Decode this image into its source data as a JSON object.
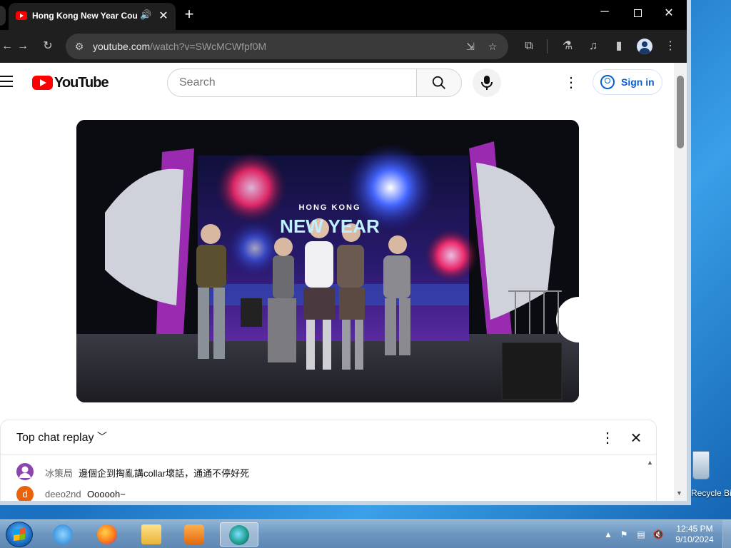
{
  "browser": {
    "tab_title": "Hong Kong New Year Countdown",
    "url_host": "youtube.com",
    "url_path": "/watch?v=SWcMCWfpf0M"
  },
  "youtube": {
    "logo_text": "YouTube",
    "search_placeholder": "Search",
    "sign_in_label": "Sign in"
  },
  "video": {
    "screen_text_top": "HONG KONG",
    "screen_text_main": "NEW YEAR"
  },
  "chat": {
    "title": "Top chat replay",
    "messages": [
      {
        "author": "冰策局",
        "text": "邊個企到掏亂講collar壞話，通通不停好死",
        "avatar_color": "#8e44ad",
        "avatar_letter": ""
      },
      {
        "author": "deeo2nd",
        "text": "Oooooh~",
        "avatar_color": "#e8630a",
        "avatar_letter": "d"
      }
    ]
  },
  "desktop": {
    "recycle_bin_label": "Recycle Bin"
  },
  "taskbar": {
    "time": "12:45 PM",
    "date": "9/10/2024"
  }
}
